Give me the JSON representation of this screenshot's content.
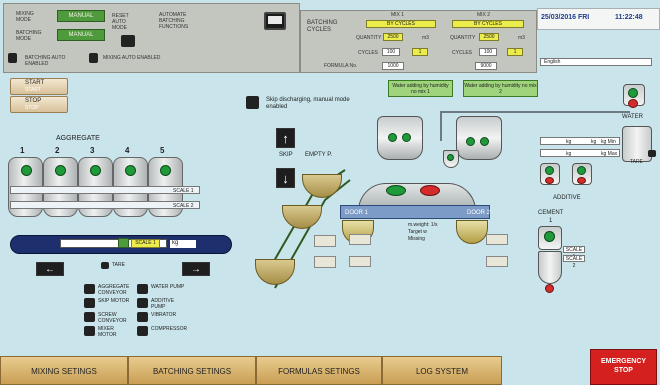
{
  "header": {
    "mode_labels": [
      "MIXING MODE",
      "BATCHING MODE"
    ],
    "mode_values": [
      "MANUAL",
      "MANUAL"
    ],
    "reset_label": "RESET AUTO MODE",
    "auto_label_1": "AUTOMATE",
    "auto_label_2": "BATCHING",
    "auto_label_3": "FUNCTIONS",
    "bottom_left_labels": [
      "BATCHING AUTO ENABLED",
      "MIXING AUTO ENABLED"
    ]
  },
  "batching": {
    "title": "BATCHING CYCLES",
    "formula_label": "FORMULA No.",
    "formula_value": "1000",
    "mix1": {
      "title": "MIX 1",
      "mode": "BY CYCLES",
      "quantity_label": "QUANTITY",
      "quantity_value": "2500",
      "unit": "m3",
      "cycles_label": "CYCLES",
      "cycles_value": "100",
      "cycles_value_2": "1"
    },
    "mix2": {
      "title": "MIX 2",
      "mode": "BY CYCLES",
      "quantity_label": "QUANTITY",
      "quantity_value": "2500",
      "unit": "m3",
      "cycles_label": "CYCLES",
      "cycles_value": "100",
      "cycles_value_2": "1"
    },
    "formula_value_2": "9000"
  },
  "clock": {
    "date": "25/03/2016 FRI",
    "time": "11:22:48"
  },
  "language": "English",
  "aggregate": {
    "title": "AGGREGATE",
    "silos": [
      "1",
      "2",
      "3",
      "4",
      "5"
    ],
    "unit": "kg",
    "scale_label_1": "SCALE 1",
    "scale_label_2": "SCALE 2",
    "conveyor_label": "SCALE 1",
    "conveyor_unit": "kg",
    "tare_label": "TARE"
  },
  "top_left": {
    "start_label": "START",
    "stop_label": "STOP",
    "btn1": "START",
    "btn2": "STOP"
  },
  "skip": {
    "message": "Skip discharging, manual mode enabled",
    "label": "SKIP",
    "empty_label": "EMPTY P."
  },
  "mixer": {
    "door1": "DOOR 1",
    "door2": "DOOR 2",
    "notes": [
      "m.weight: 1/s",
      "Target w",
      "Missing"
    ],
    "buttons": [
      "OPEN",
      "CLOSE",
      "OPEN",
      "CLOSE"
    ]
  },
  "water": {
    "title": "WATER",
    "msg_left": "Water adding by humidity no mix 1",
    "msg_right": "Water adding by humidity no mix 2",
    "tare_label": "TARE"
  },
  "additive": {
    "title": "ADDITIVE",
    "units": [
      "kg",
      "kg",
      "kg",
      "kg"
    ],
    "values": [
      "kg Min",
      "kg Max"
    ]
  },
  "cement": {
    "title": "CEMENT",
    "sub": "1",
    "scale_label_1": "SCALE 1",
    "scale_label_2": "SCALE 2"
  },
  "motors": [
    "AGGREGATE CONVEYOR",
    "SKIP MOTOR",
    "SCREW CONVEYOR",
    "MIXER MOTOR",
    "WATER PUMP",
    "ADDITIVE PUMP",
    "VIBRATOR",
    "COMPRESSOR"
  ],
  "tabs": [
    "MIXING SETINGS",
    "BATCHING SETINGS",
    "FORMULAS SETINGS",
    "LOG SYSTEM"
  ],
  "emergency": [
    "EMERGENCY",
    "STOP"
  ]
}
